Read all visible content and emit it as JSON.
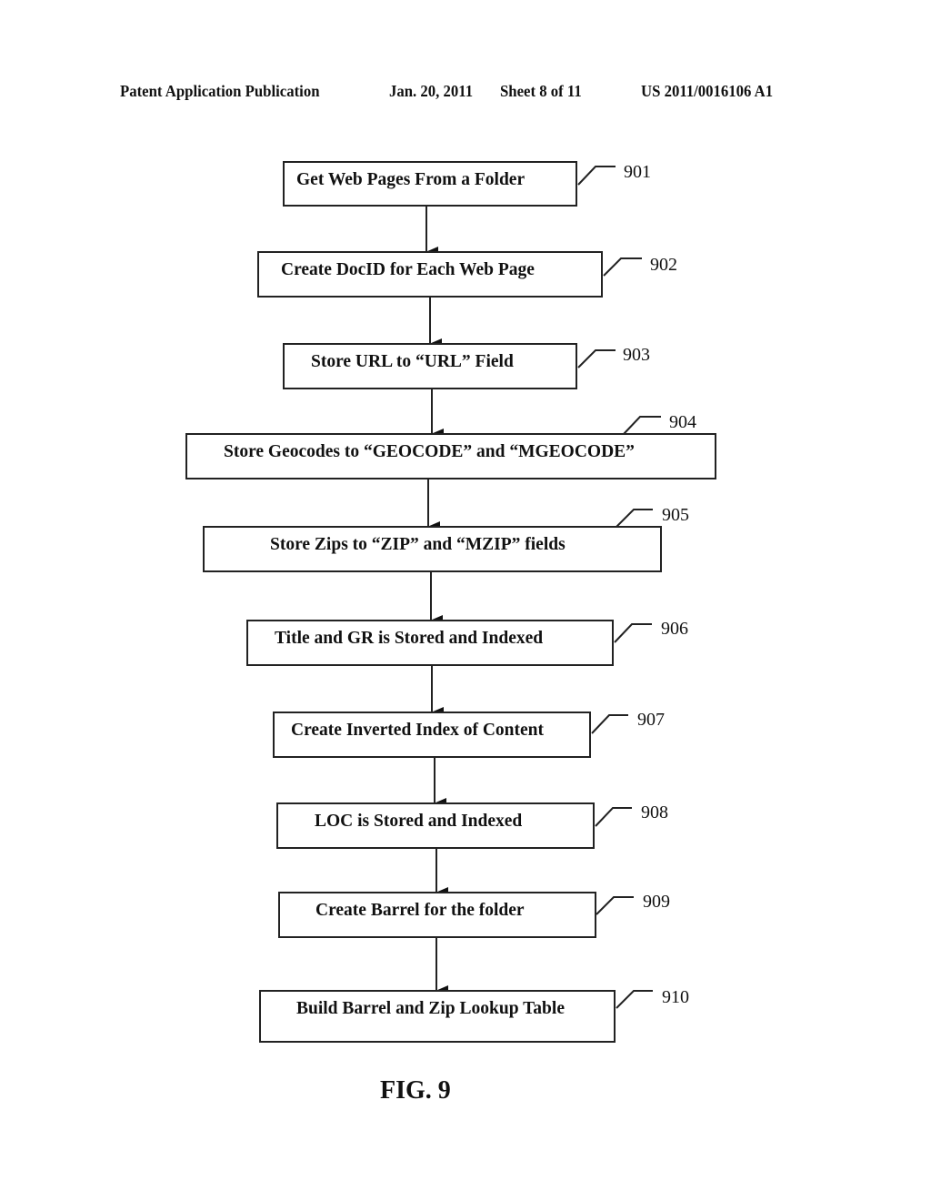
{
  "header": {
    "publication": "Patent Application Publication",
    "date": "Jan. 20, 2011",
    "sheet": "Sheet 8 of 11",
    "patent_number": "US 2011/0016106 A1"
  },
  "flowchart": {
    "steps": [
      {
        "ref": "901",
        "label": "Get Web Pages From a Folder"
      },
      {
        "ref": "902",
        "label": "Create DocID for Each Web Page"
      },
      {
        "ref": "903",
        "label": "Store URL to “URL” Field"
      },
      {
        "ref": "904",
        "label": "Store Geocodes to “GEOCODE” and “MGEOCODE”"
      },
      {
        "ref": "905",
        "label": "Store Zips to “ZIP” and “MZIP” fields"
      },
      {
        "ref": "906",
        "label": "Title and GR is Stored and Indexed"
      },
      {
        "ref": "907",
        "label": "Create Inverted Index of Content"
      },
      {
        "ref": "908",
        "label": "LOC is Stored and Indexed"
      },
      {
        "ref": "909",
        "label": "Create Barrel for the folder"
      },
      {
        "ref": "910",
        "label": "Build Barrel and Zip Lookup Table"
      }
    ]
  },
  "figure_label": "FIG. 9"
}
